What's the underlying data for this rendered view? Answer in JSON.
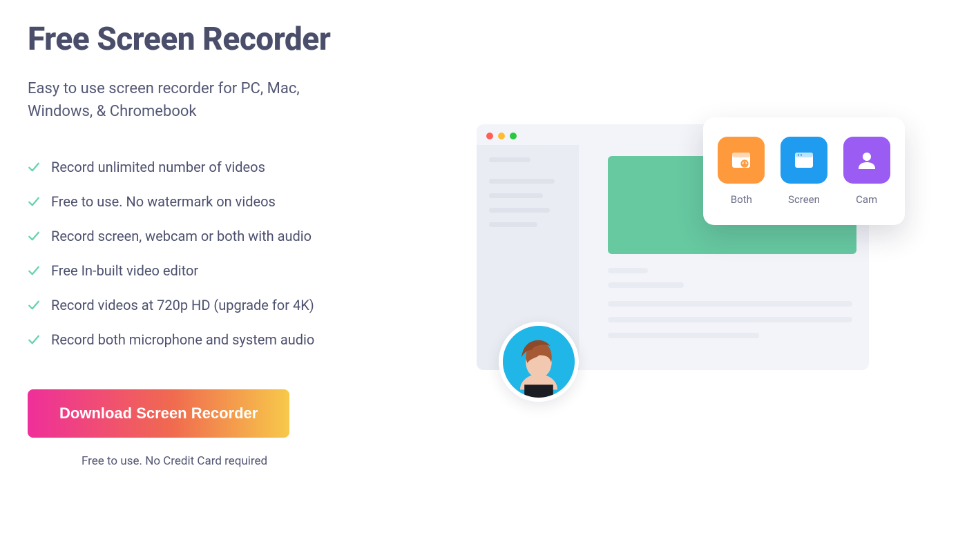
{
  "hero": {
    "title": "Free Screen Recorder",
    "subtitle": "Easy to use screen recorder for PC, Mac, Windows, & Chromebook"
  },
  "features": [
    "Record unlimited number of videos",
    "Free to use. No watermark on videos",
    "Record screen, webcam or both with audio",
    "Free In-built video editor",
    "Record videos at 720p HD (upgrade for 4K)",
    "Record both microphone and system audio"
  ],
  "cta": {
    "label": "Download Screen Recorder",
    "disclaimer": "Free to use. No Credit Card required"
  },
  "recorder_options": {
    "both": "Both",
    "screen": "Screen",
    "cam": "Cam"
  },
  "colors": {
    "accent_orange": "#ff9a3c",
    "accent_blue": "#1f9cf0",
    "accent_purple": "#9a5cf2",
    "media_green": "#66c9a0",
    "text_heading": "#4a4e6b"
  }
}
